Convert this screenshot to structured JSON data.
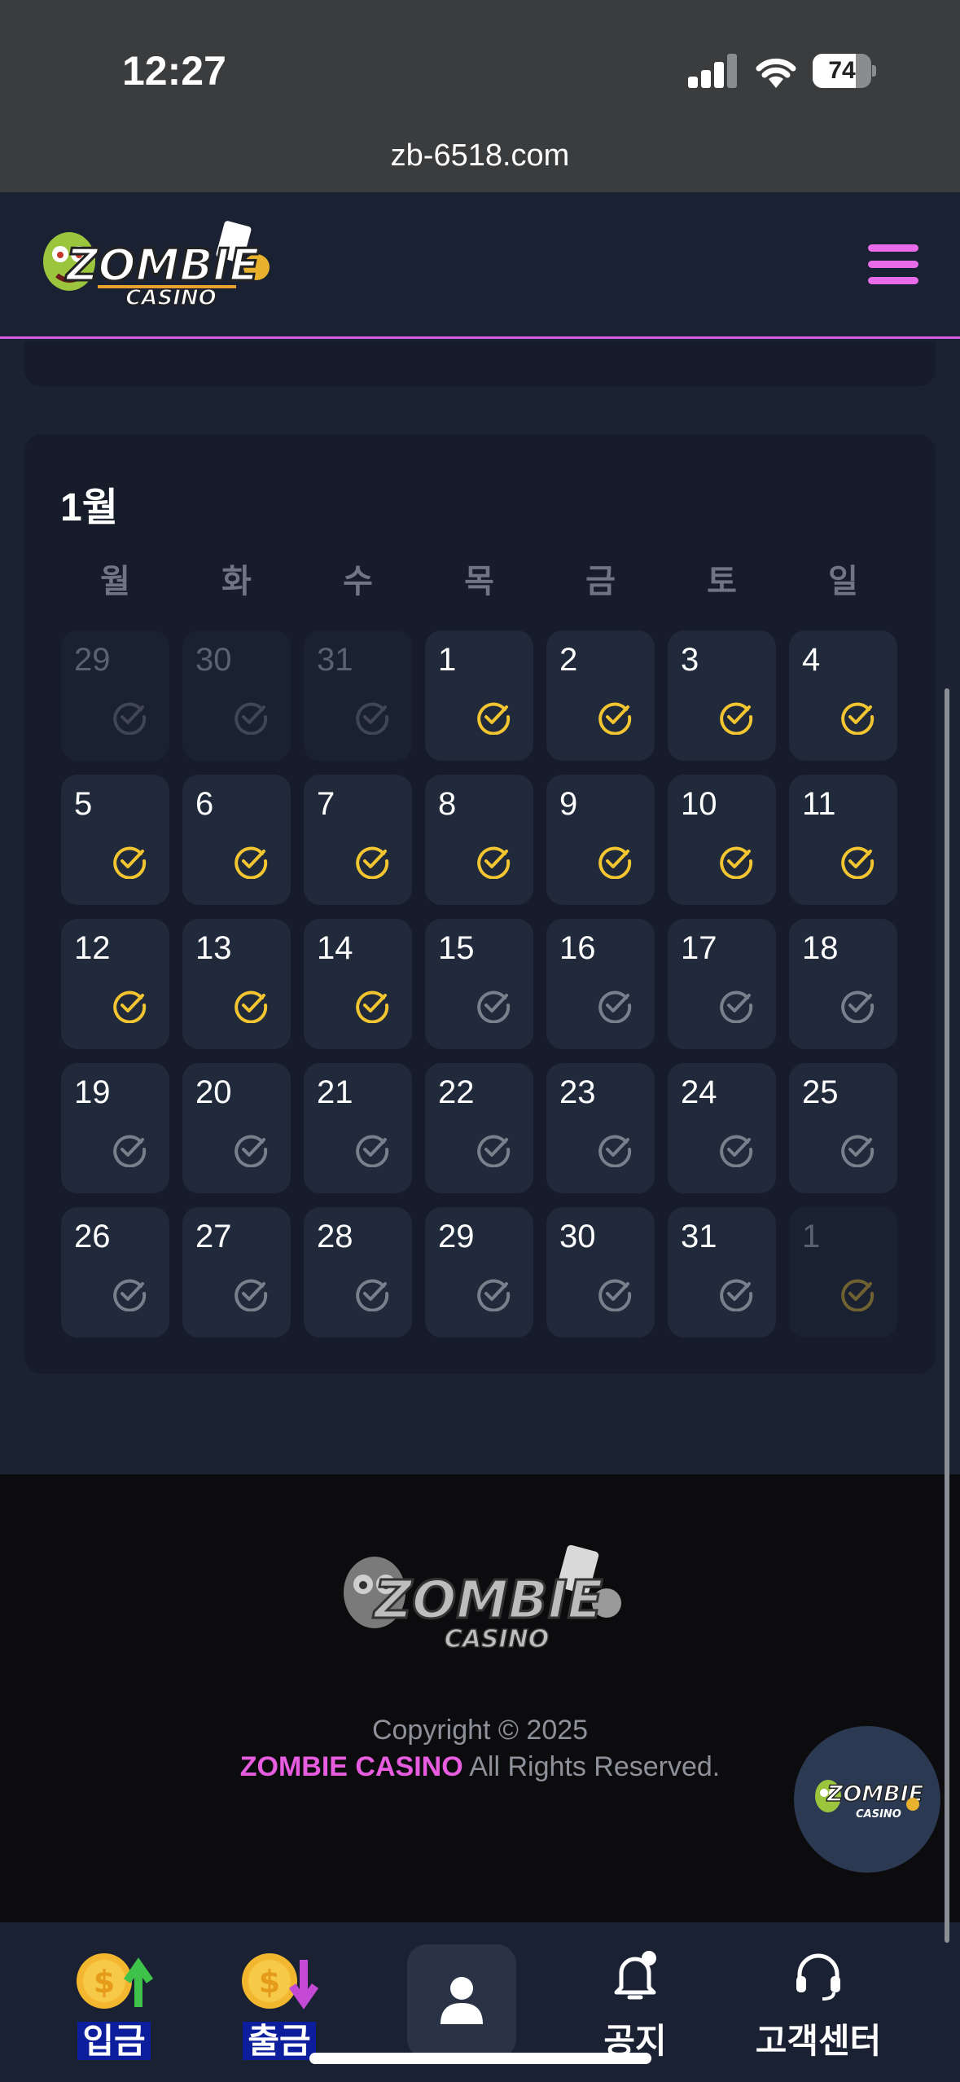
{
  "status_bar": {
    "time": "12:27",
    "battery": "74",
    "battery_level": 0.74
  },
  "browser": {
    "url": "zb-6518.com"
  },
  "header": {
    "logo": "ZOMBIE CASINO",
    "menu_icon": "hamburger-icon"
  },
  "calendar": {
    "month": "1월",
    "weekdays": [
      "월",
      "화",
      "수",
      "목",
      "금",
      "토",
      "일"
    ],
    "days": [
      {
        "day": "29",
        "in_month": false,
        "checked": false
      },
      {
        "day": "30",
        "in_month": false,
        "checked": false
      },
      {
        "day": "31",
        "in_month": false,
        "checked": false
      },
      {
        "day": "1",
        "in_month": true,
        "checked": true
      },
      {
        "day": "2",
        "in_month": true,
        "checked": true
      },
      {
        "day": "3",
        "in_month": true,
        "checked": true
      },
      {
        "day": "4",
        "in_month": true,
        "checked": true
      },
      {
        "day": "5",
        "in_month": true,
        "checked": true
      },
      {
        "day": "6",
        "in_month": true,
        "checked": true
      },
      {
        "day": "7",
        "in_month": true,
        "checked": true
      },
      {
        "day": "8",
        "in_month": true,
        "checked": true
      },
      {
        "day": "9",
        "in_month": true,
        "checked": true
      },
      {
        "day": "10",
        "in_month": true,
        "checked": true
      },
      {
        "day": "11",
        "in_month": true,
        "checked": true
      },
      {
        "day": "12",
        "in_month": true,
        "checked": true
      },
      {
        "day": "13",
        "in_month": true,
        "checked": true
      },
      {
        "day": "14",
        "in_month": true,
        "checked": true
      },
      {
        "day": "15",
        "in_month": true,
        "checked": false
      },
      {
        "day": "16",
        "in_month": true,
        "checked": false
      },
      {
        "day": "17",
        "in_month": true,
        "checked": false
      },
      {
        "day": "18",
        "in_month": true,
        "checked": false
      },
      {
        "day": "19",
        "in_month": true,
        "checked": false
      },
      {
        "day": "20",
        "in_month": true,
        "checked": false
      },
      {
        "day": "21",
        "in_month": true,
        "checked": false
      },
      {
        "day": "22",
        "in_month": true,
        "checked": false
      },
      {
        "day": "23",
        "in_month": true,
        "checked": false
      },
      {
        "day": "24",
        "in_month": true,
        "checked": false
      },
      {
        "day": "25",
        "in_month": true,
        "checked": false
      },
      {
        "day": "26",
        "in_month": true,
        "checked": false
      },
      {
        "day": "27",
        "in_month": true,
        "checked": false
      },
      {
        "day": "28",
        "in_month": true,
        "checked": false
      },
      {
        "day": "29",
        "in_month": true,
        "checked": false
      },
      {
        "day": "30",
        "in_month": true,
        "checked": false
      },
      {
        "day": "31",
        "in_month": true,
        "checked": false
      },
      {
        "day": "1",
        "in_month": false,
        "checked": true
      }
    ]
  },
  "footer": {
    "logo": "ZOMBIE CASINO",
    "copyright": "Copyright © 2025",
    "brand": "ZOMBIE CASINO",
    "rights": " All Rights Reserved."
  },
  "bottom_nav": [
    {
      "label": "입금",
      "icon": "deposit-coin-icon"
    },
    {
      "label": "출금",
      "icon": "withdraw-coin-icon"
    },
    {
      "label": "",
      "icon": "profile-icon"
    },
    {
      "label": "공지",
      "icon": "notice-bell-icon"
    },
    {
      "label": "고객센터",
      "icon": "headset-icon"
    }
  ],
  "colors": {
    "accent_pink": "#e85de0",
    "check_gold": "#f2c531",
    "check_gray": "#7a7f8c",
    "background": "#1b2333"
  }
}
